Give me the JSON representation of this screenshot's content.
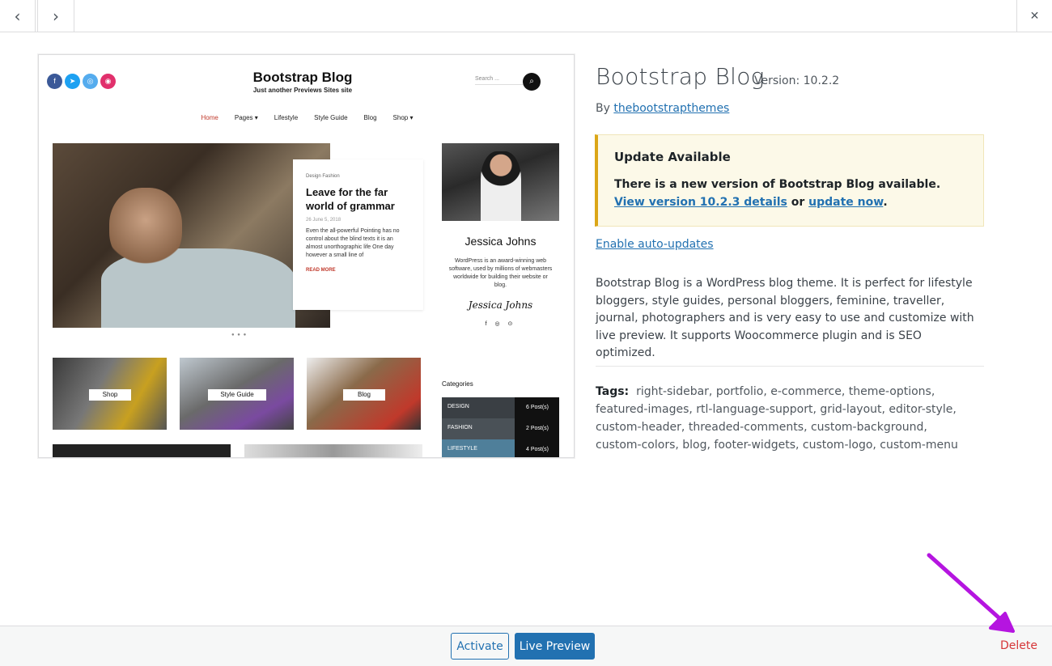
{
  "nav": {
    "prev_icon": "‹",
    "next_icon": "›",
    "close_icon": "✕"
  },
  "screenshot": {
    "brand_title": "Bootstrap Blog",
    "brand_subtitle": "Just another Previews Sites site",
    "search_placeholder": "Search ...",
    "menu": [
      "Home",
      "Pages ▾",
      "Lifestyle",
      "Style Guide",
      "Blog",
      "Shop ▾"
    ],
    "hero_categories": "Design   Fashion",
    "hero_title": "Leave for the far world of grammar",
    "hero_date": "26 June 5, 2018",
    "hero_excerpt": "Even the all-powerful Pointing has no control about the blind texts it is an almost unorthographic life One day however a small line of",
    "hero_more": "READ MORE",
    "tiles": [
      "Shop",
      "Style Guide",
      "Blog"
    ],
    "author_name": "Jessica Johns",
    "author_bio": "WordPress is an award-winning web software, used by millions of webmasters worldwide for building their website or blog.",
    "author_signature": "Jessica Johns",
    "author_icons": "f ◎ ⊙",
    "categories_title": "Categories",
    "categories": [
      {
        "name": "DESIGN",
        "count": "6 Post(s)"
      },
      {
        "name": "FASHION",
        "count": "2 Post(s)"
      },
      {
        "name": "LIFESTYLE",
        "count": "4 Post(s)"
      }
    ]
  },
  "theme": {
    "name": "Bootstrap Blog",
    "version": "Version: 10.2.2",
    "by": "By ",
    "author": "thebootstrapthemes",
    "notice_heading": "Update Available",
    "notice_text": "There is a new version of Bootstrap Blog available. ",
    "notice_link1": "View version 10.2.3 details",
    "notice_or": " or ",
    "notice_link2": "update now",
    "notice_end": ".",
    "auto_updates": "Enable auto-updates",
    "description": "Bootstrap Blog is a WordPress blog theme. It is perfect for lifestyle bloggers, style guides, personal bloggers, feminine, traveller, journal, photographers and is very easy to use and customize with live preview. It supports Woocommerce plugin and is SEO optimized.",
    "tags_label": "Tags:",
    "tags": "right-sidebar, portfolio, e-commerce, theme-options, featured-images, rtl-language-support, grid-layout, editor-style, custom-header, threaded-comments, custom-background, custom-colors, blog, footer-widgets, custom-logo, custom-menu"
  },
  "footer": {
    "activate": "Activate",
    "live_preview": "Live Preview",
    "delete": "Delete"
  },
  "colors": {
    "accent": "#2271b1",
    "delete": "#d63638",
    "arrow": "#b515e0",
    "notice_border": "#dba617"
  }
}
